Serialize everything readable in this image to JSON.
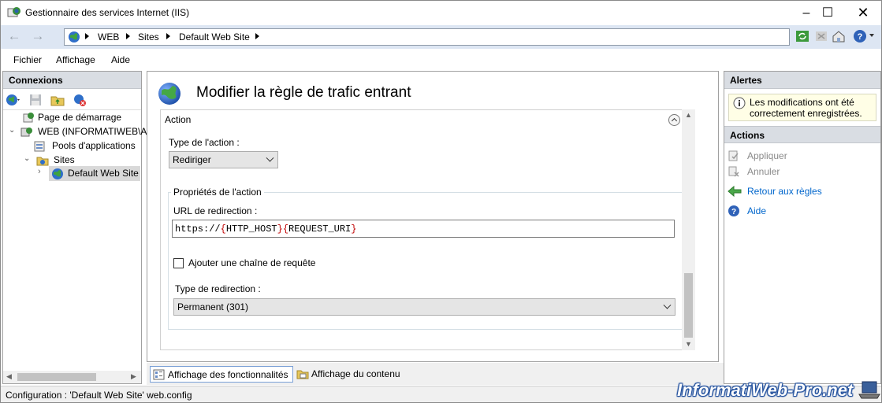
{
  "window": {
    "title": "Gestionnaire des services Internet (IIS)"
  },
  "address": {
    "crumbs": [
      "WEB",
      "Sites",
      "Default Web Site"
    ]
  },
  "menu": {
    "file": "Fichier",
    "view": "Affichage",
    "help": "Aide"
  },
  "connections": {
    "title": "Connexions",
    "tree": {
      "start_page": "Page de démarrage",
      "server": "WEB (INFORMATIWEB\\Ad",
      "app_pools": "Pools d'applications",
      "sites": "Sites",
      "default_site": "Default Web Site"
    }
  },
  "feature": {
    "title": "Modifier la règle de trafic entrant",
    "section": "Action",
    "action_type_label": "Type de l'action :",
    "action_type_value": "Rediriger",
    "group_title": "Propriétés de l'action",
    "url_label": "URL de redirection :",
    "url_parts": {
      "prefix": "https://",
      "open1": "{",
      "var1": "HTTP_HOST",
      "close1": "}",
      "open2": "{",
      "var2": "REQUEST_URI",
      "close2": "}"
    },
    "append_query_label": "Ajouter une chaîne de requête",
    "append_query_checked": false,
    "redirect_type_label": "Type de redirection :",
    "redirect_type_value": "Permanent (301)"
  },
  "bottom_tabs": {
    "features_view": "Affichage des fonctionnalités",
    "content_view": "Affichage du contenu"
  },
  "status": {
    "text": "Configuration : 'Default Web Site' web.config"
  },
  "alerts": {
    "title": "Alertes",
    "message": "Les modifications ont été correctement enregistrées."
  },
  "actions": {
    "title": "Actions",
    "apply": "Appliquer",
    "cancel": "Annuler",
    "back_to_rules": "Retour aux règles",
    "help": "Aide"
  },
  "watermark": "InformatiWeb-Pro.net",
  "colors": {
    "accent_blue": "#0066cc",
    "header_gray": "#d9dde3",
    "address_bg": "#dde6f3",
    "disabled": "#8a8a8a"
  }
}
